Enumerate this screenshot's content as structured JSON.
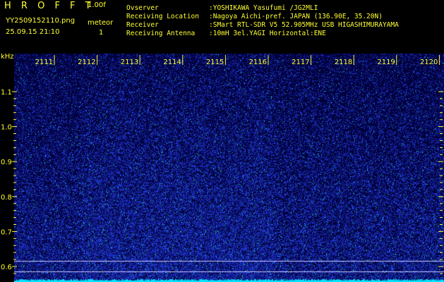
{
  "header": {
    "app_title": "H R O F F T",
    "version": "1.00f",
    "filename": "YY2509152110.png",
    "meteor_label": "meteor",
    "datetime": "25.09.15 21:10",
    "meteor_count": "1",
    "info": [
      {
        "label": "Ovserver",
        "value": ":YOSHIKAWA Yasufumi /JG2MLI"
      },
      {
        "label": "Receiving Location",
        "value": ":Nagoya Aichi-pref. JAPAN (136.90E, 35.20N)"
      },
      {
        "label": "Receiver",
        "value": ":SMart RTL-SDR V5 52.905MHz USB HIGASHIMURAYAMA"
      },
      {
        "label": "Receiving Antenna",
        "value": ":10mH 3el.YAGI Horizontal:ENE"
      }
    ]
  },
  "spectrogram": {
    "y_unit": "kHz",
    "x_ticks": [
      "2111",
      "2112",
      "2113",
      "2114",
      "2115",
      "2116",
      "2117",
      "2118",
      "2119",
      "2120"
    ],
    "y_ticks": [
      "1.1",
      "1.0",
      "0.9",
      "0.8",
      "0.7",
      "0.6"
    ],
    "y_range_khz": [
      0.58,
      1.2
    ],
    "colors": {
      "background": "#00003a",
      "noise": "#2233ff",
      "ticks": "#ffff33",
      "baseline": "#00e5ff",
      "marker_lines": "#c8c8ff"
    }
  }
}
